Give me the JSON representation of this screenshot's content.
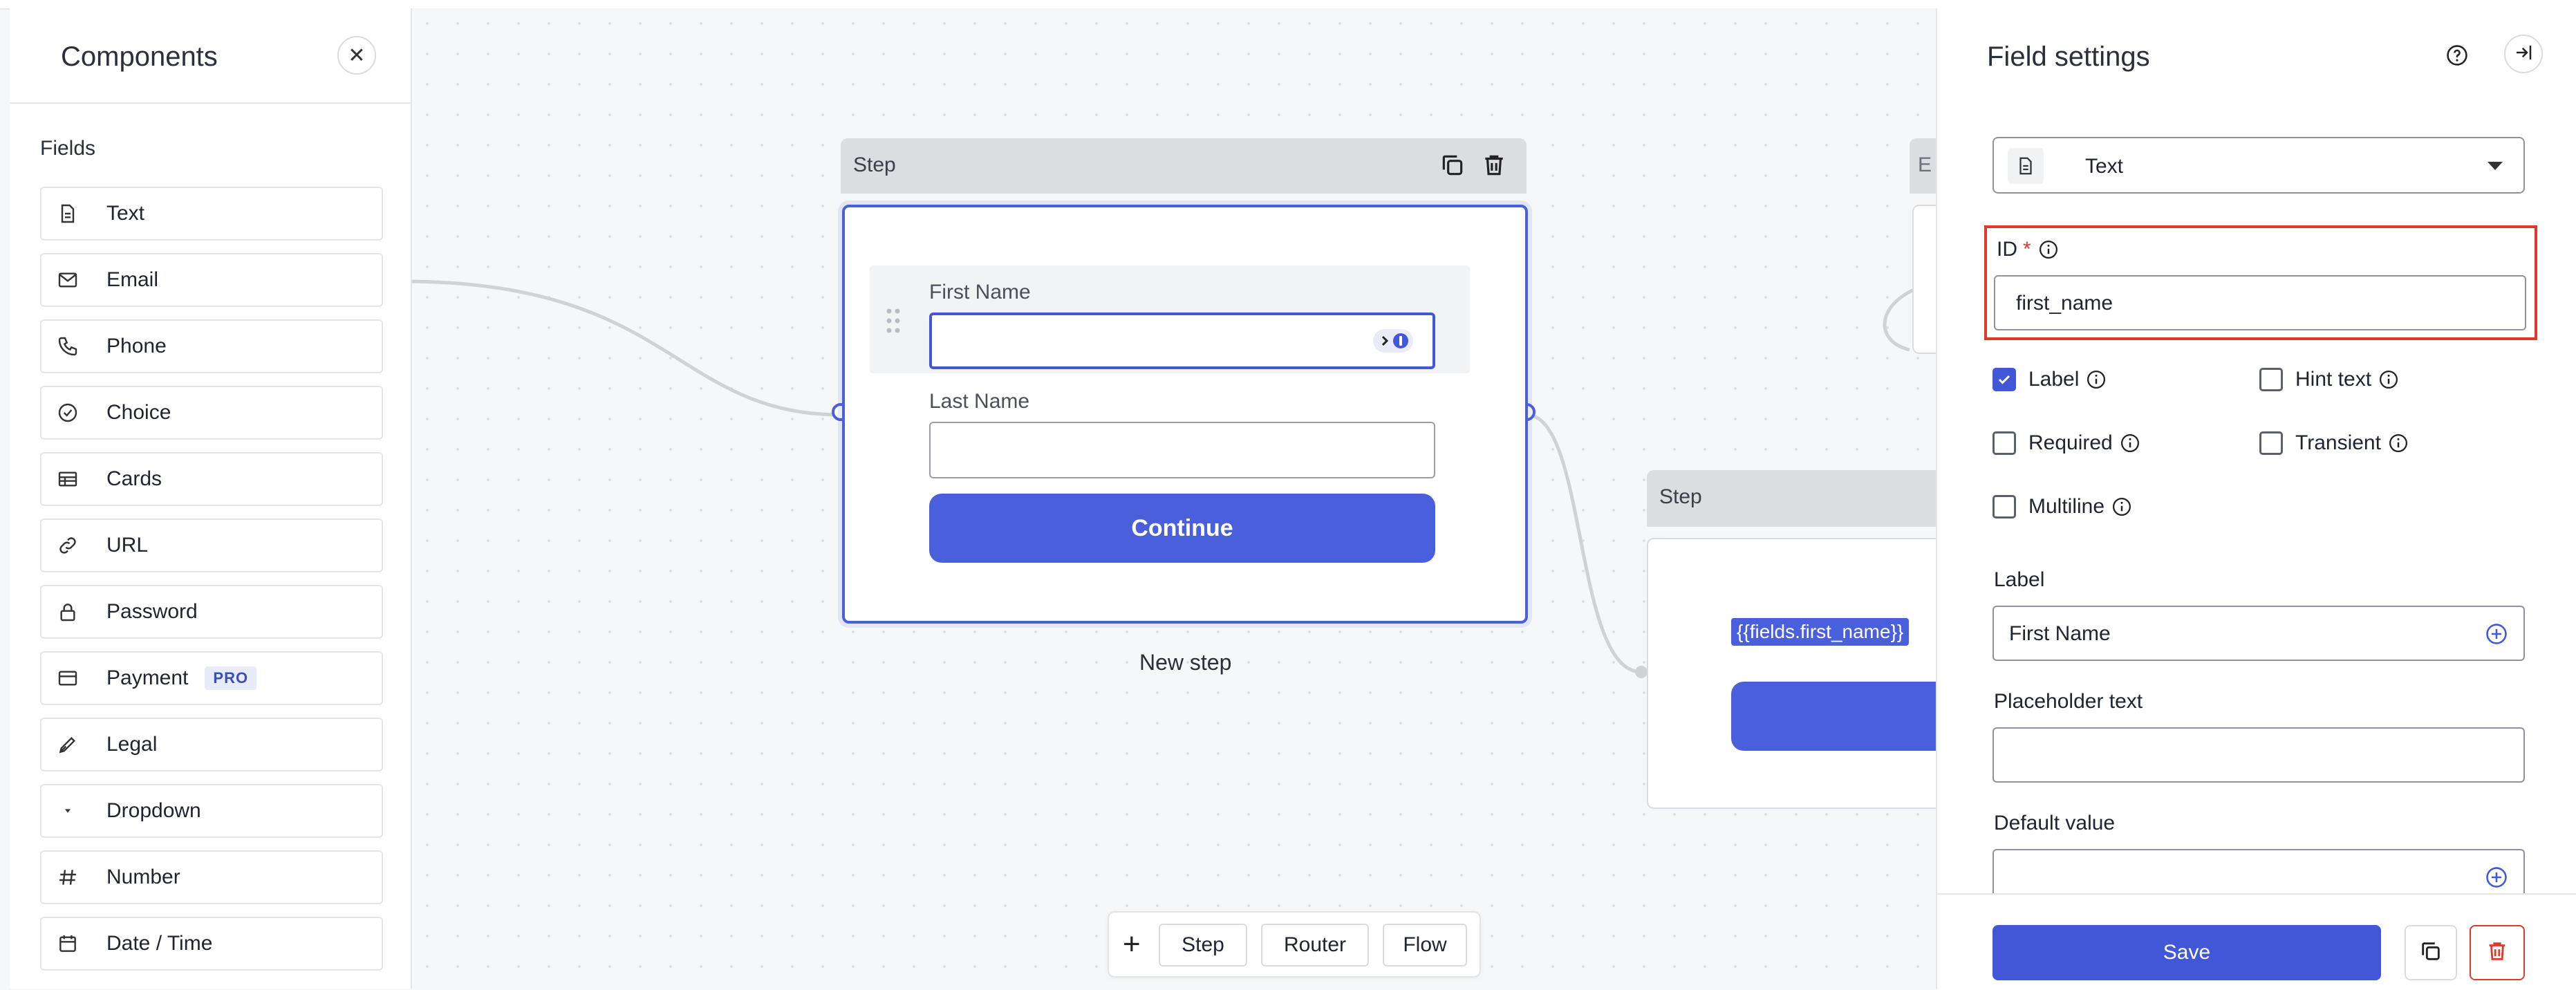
{
  "components_panel": {
    "title": "Components",
    "section": "Fields",
    "items": [
      {
        "label": "Text",
        "icon": "document-icon"
      },
      {
        "label": "Email",
        "icon": "mail-icon"
      },
      {
        "label": "Phone",
        "icon": "phone-icon"
      },
      {
        "label": "Choice",
        "icon": "check-circle-icon"
      },
      {
        "label": "Cards",
        "icon": "table-icon"
      },
      {
        "label": "URL",
        "icon": "link-icon"
      },
      {
        "label": "Password",
        "icon": "lock-icon"
      },
      {
        "label": "Payment",
        "icon": "credit-card-icon",
        "badge": "PRO"
      },
      {
        "label": "Legal",
        "icon": "pen-nib-icon"
      },
      {
        "label": "Dropdown",
        "icon": "caret-down-icon"
      },
      {
        "label": "Number",
        "icon": "hash-icon"
      },
      {
        "label": "Date / Time",
        "icon": "calendar-icon"
      }
    ]
  },
  "canvas": {
    "step1": {
      "header": "Step",
      "field1_label": "First Name",
      "field2_label": "Last Name",
      "button": "Continue",
      "caption": "New step"
    },
    "step2": {
      "header": "Step",
      "template_chip": "{{fields.first_name}}"
    },
    "step3": {
      "header": "E"
    },
    "toolbar": {
      "add": "+",
      "step": "Step",
      "router": "Router",
      "flow": "Flow"
    }
  },
  "settings": {
    "title": "Field settings",
    "type_value": "Text",
    "id_label": "ID",
    "id_required": "*",
    "id_value": "first_name",
    "checkboxes": {
      "label": "Label",
      "hint_text": "Hint text",
      "required": "Required",
      "transient": "Transient",
      "multiline": "Multiline"
    },
    "label_heading": "Label",
    "label_value": "First Name",
    "placeholder_heading": "Placeholder text",
    "placeholder_value": "",
    "default_heading": "Default value",
    "default_value": "",
    "save": "Save"
  },
  "colors": {
    "accent": "#4257d8",
    "danger": "#e0392b"
  }
}
